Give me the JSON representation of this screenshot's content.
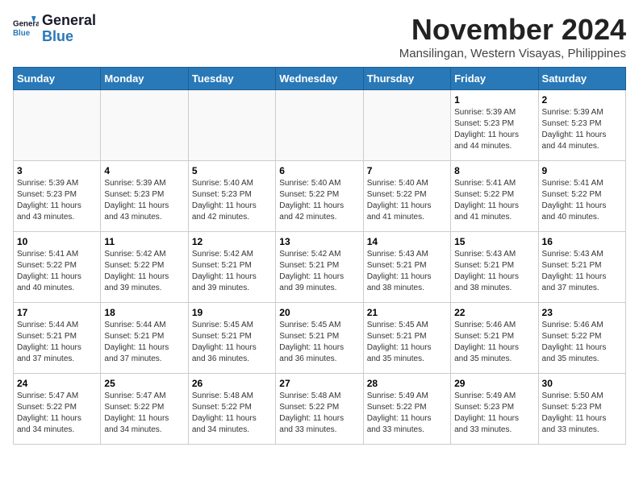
{
  "header": {
    "logo_line1": "General",
    "logo_line2": "Blue",
    "month_title": "November 2024",
    "location": "Mansilingan, Western Visayas, Philippines"
  },
  "weekdays": [
    "Sunday",
    "Monday",
    "Tuesday",
    "Wednesday",
    "Thursday",
    "Friday",
    "Saturday"
  ],
  "weeks": [
    [
      {
        "day": "",
        "info": ""
      },
      {
        "day": "",
        "info": ""
      },
      {
        "day": "",
        "info": ""
      },
      {
        "day": "",
        "info": ""
      },
      {
        "day": "",
        "info": ""
      },
      {
        "day": "1",
        "info": "Sunrise: 5:39 AM\nSunset: 5:23 PM\nDaylight: 11 hours\nand 44 minutes."
      },
      {
        "day": "2",
        "info": "Sunrise: 5:39 AM\nSunset: 5:23 PM\nDaylight: 11 hours\nand 44 minutes."
      }
    ],
    [
      {
        "day": "3",
        "info": "Sunrise: 5:39 AM\nSunset: 5:23 PM\nDaylight: 11 hours\nand 43 minutes."
      },
      {
        "day": "4",
        "info": "Sunrise: 5:39 AM\nSunset: 5:23 PM\nDaylight: 11 hours\nand 43 minutes."
      },
      {
        "day": "5",
        "info": "Sunrise: 5:40 AM\nSunset: 5:23 PM\nDaylight: 11 hours\nand 42 minutes."
      },
      {
        "day": "6",
        "info": "Sunrise: 5:40 AM\nSunset: 5:22 PM\nDaylight: 11 hours\nand 42 minutes."
      },
      {
        "day": "7",
        "info": "Sunrise: 5:40 AM\nSunset: 5:22 PM\nDaylight: 11 hours\nand 41 minutes."
      },
      {
        "day": "8",
        "info": "Sunrise: 5:41 AM\nSunset: 5:22 PM\nDaylight: 11 hours\nand 41 minutes."
      },
      {
        "day": "9",
        "info": "Sunrise: 5:41 AM\nSunset: 5:22 PM\nDaylight: 11 hours\nand 40 minutes."
      }
    ],
    [
      {
        "day": "10",
        "info": "Sunrise: 5:41 AM\nSunset: 5:22 PM\nDaylight: 11 hours\nand 40 minutes."
      },
      {
        "day": "11",
        "info": "Sunrise: 5:42 AM\nSunset: 5:22 PM\nDaylight: 11 hours\nand 39 minutes."
      },
      {
        "day": "12",
        "info": "Sunrise: 5:42 AM\nSunset: 5:21 PM\nDaylight: 11 hours\nand 39 minutes."
      },
      {
        "day": "13",
        "info": "Sunrise: 5:42 AM\nSunset: 5:21 PM\nDaylight: 11 hours\nand 39 minutes."
      },
      {
        "day": "14",
        "info": "Sunrise: 5:43 AM\nSunset: 5:21 PM\nDaylight: 11 hours\nand 38 minutes."
      },
      {
        "day": "15",
        "info": "Sunrise: 5:43 AM\nSunset: 5:21 PM\nDaylight: 11 hours\nand 38 minutes."
      },
      {
        "day": "16",
        "info": "Sunrise: 5:43 AM\nSunset: 5:21 PM\nDaylight: 11 hours\nand 37 minutes."
      }
    ],
    [
      {
        "day": "17",
        "info": "Sunrise: 5:44 AM\nSunset: 5:21 PM\nDaylight: 11 hours\nand 37 minutes."
      },
      {
        "day": "18",
        "info": "Sunrise: 5:44 AM\nSunset: 5:21 PM\nDaylight: 11 hours\nand 37 minutes."
      },
      {
        "day": "19",
        "info": "Sunrise: 5:45 AM\nSunset: 5:21 PM\nDaylight: 11 hours\nand 36 minutes."
      },
      {
        "day": "20",
        "info": "Sunrise: 5:45 AM\nSunset: 5:21 PM\nDaylight: 11 hours\nand 36 minutes."
      },
      {
        "day": "21",
        "info": "Sunrise: 5:45 AM\nSunset: 5:21 PM\nDaylight: 11 hours\nand 35 minutes."
      },
      {
        "day": "22",
        "info": "Sunrise: 5:46 AM\nSunset: 5:21 PM\nDaylight: 11 hours\nand 35 minutes."
      },
      {
        "day": "23",
        "info": "Sunrise: 5:46 AM\nSunset: 5:22 PM\nDaylight: 11 hours\nand 35 minutes."
      }
    ],
    [
      {
        "day": "24",
        "info": "Sunrise: 5:47 AM\nSunset: 5:22 PM\nDaylight: 11 hours\nand 34 minutes."
      },
      {
        "day": "25",
        "info": "Sunrise: 5:47 AM\nSunset: 5:22 PM\nDaylight: 11 hours\nand 34 minutes."
      },
      {
        "day": "26",
        "info": "Sunrise: 5:48 AM\nSunset: 5:22 PM\nDaylight: 11 hours\nand 34 minutes."
      },
      {
        "day": "27",
        "info": "Sunrise: 5:48 AM\nSunset: 5:22 PM\nDaylight: 11 hours\nand 33 minutes."
      },
      {
        "day": "28",
        "info": "Sunrise: 5:49 AM\nSunset: 5:22 PM\nDaylight: 11 hours\nand 33 minutes."
      },
      {
        "day": "29",
        "info": "Sunrise: 5:49 AM\nSunset: 5:23 PM\nDaylight: 11 hours\nand 33 minutes."
      },
      {
        "day": "30",
        "info": "Sunrise: 5:50 AM\nSunset: 5:23 PM\nDaylight: 11 hours\nand 33 minutes."
      }
    ]
  ]
}
